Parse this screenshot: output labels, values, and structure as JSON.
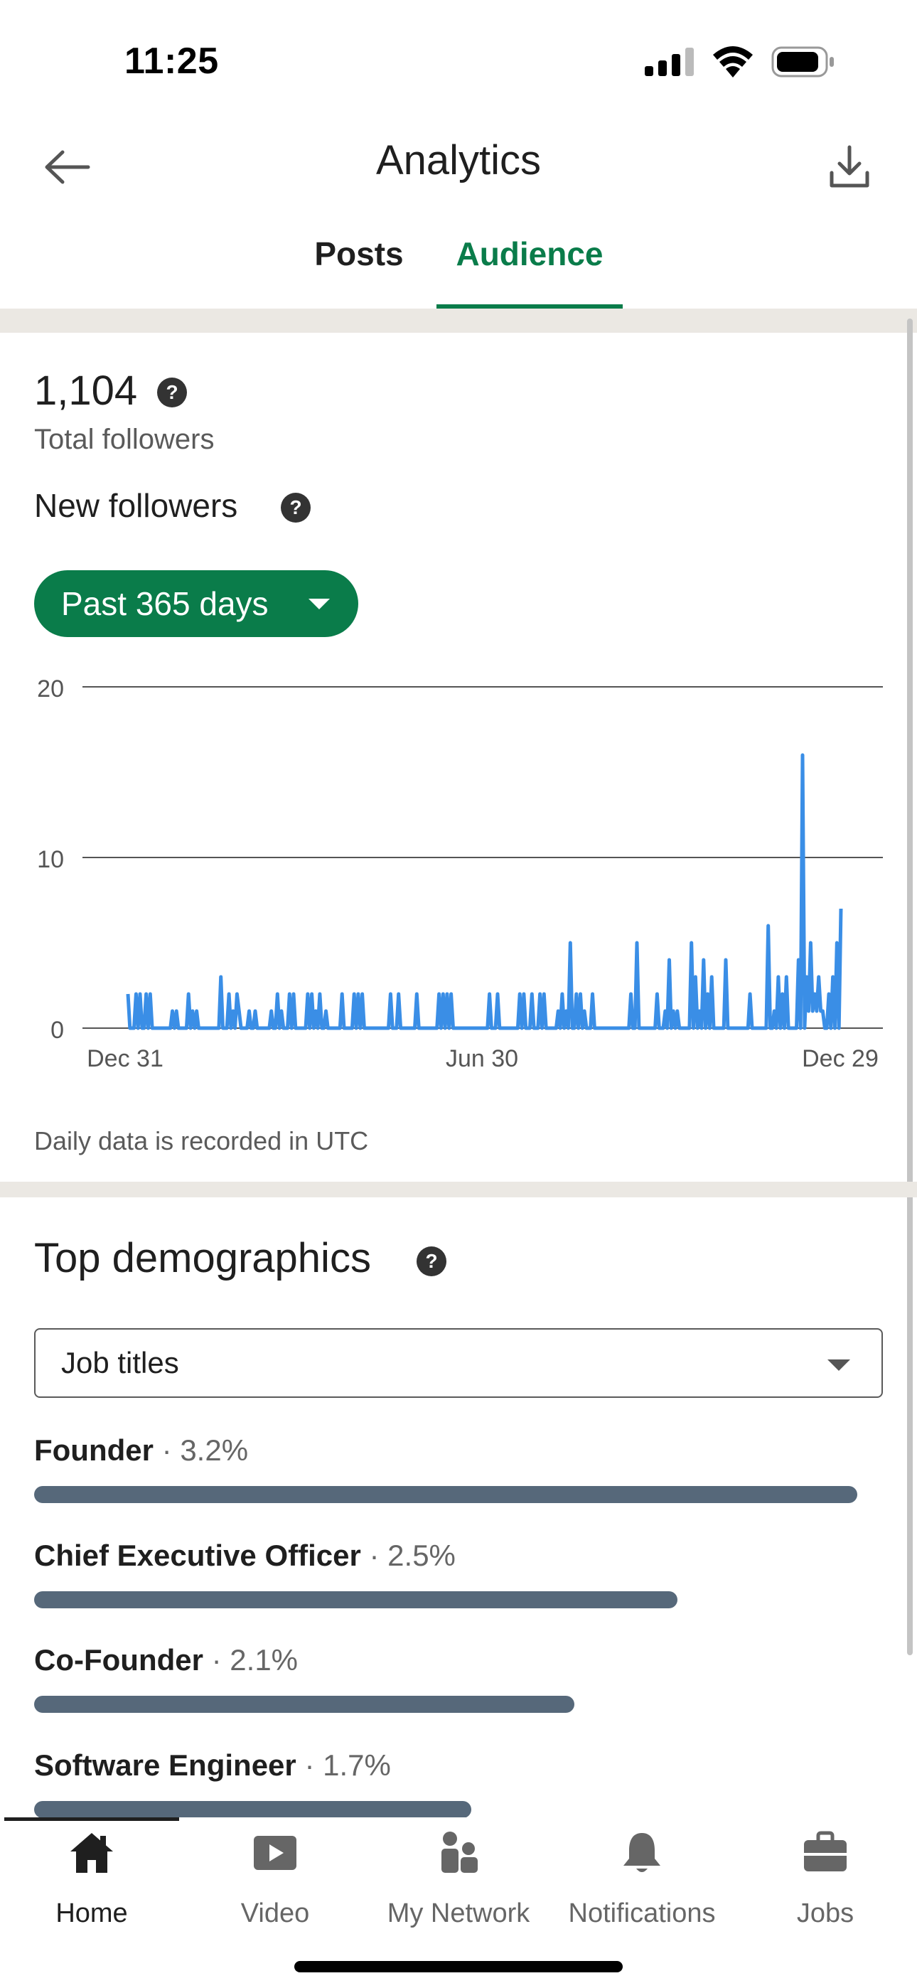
{
  "status_bar": {
    "time": "11:25"
  },
  "header": {
    "title": "Analytics"
  },
  "tabs": [
    {
      "label": "Posts",
      "active": false
    },
    {
      "label": "Audience",
      "active": true
    }
  ],
  "followers": {
    "total": "1,104",
    "total_label": "Total followers",
    "new_label": "New followers",
    "range": "Past 365 days",
    "note": "Daily data is recorded in UTC"
  },
  "chart_data": {
    "type": "line",
    "title": "",
    "xlabel": "",
    "ylabel": "",
    "ylim": [
      0,
      20
    ],
    "yticks": [
      "0",
      "10",
      "20"
    ],
    "xticks": [
      "Dec 31",
      "Jun 30",
      "Dec 29"
    ],
    "grid": true,
    "series": [
      {
        "values": [
          2,
          0,
          0,
          0,
          2,
          0,
          2,
          0,
          0,
          2,
          0,
          2,
          0,
          0,
          0,
          0,
          0,
          0,
          0,
          0,
          0,
          0,
          1,
          0,
          1,
          0,
          0,
          0,
          0,
          0,
          2,
          0,
          1,
          0,
          1,
          0,
          0,
          0,
          0,
          0,
          0,
          0,
          0,
          0,
          0,
          0,
          3,
          0,
          0,
          0,
          2,
          0,
          1,
          0,
          2,
          1,
          0,
          0,
          0,
          0,
          1,
          0,
          0,
          1,
          0,
          0,
          0,
          0,
          0,
          0,
          0,
          1,
          0,
          0,
          2,
          0,
          1,
          0,
          0,
          0,
          2,
          0,
          2,
          0,
          0,
          0,
          0,
          0,
          0,
          2,
          0,
          2,
          0,
          1,
          0,
          2,
          0,
          0,
          1,
          0,
          0,
          0,
          0,
          0,
          0,
          0,
          2,
          0,
          0,
          0,
          0,
          0,
          2,
          0,
          2,
          0,
          2,
          0,
          0,
          0,
          0,
          0,
          0,
          0,
          0,
          0,
          0,
          0,
          0,
          0,
          2,
          0,
          0,
          0,
          2,
          0,
          0,
          0,
          0,
          0,
          0,
          0,
          0,
          2,
          0,
          0,
          0,
          0,
          0,
          0,
          0,
          0,
          0,
          0,
          2,
          0,
          2,
          0,
          2,
          0,
          2,
          0,
          0,
          0,
          0,
          0,
          0,
          0,
          0,
          0,
          0,
          0,
          0,
          0,
          0,
          0,
          0,
          0,
          0,
          2,
          0,
          0,
          0,
          2,
          0,
          0,
          0,
          0,
          0,
          0,
          0,
          0,
          0,
          0,
          2,
          0,
          2,
          0,
          0,
          0,
          2,
          0,
          0,
          0,
          2,
          0,
          2,
          0,
          0,
          0,
          0,
          0,
          0,
          1,
          0,
          2,
          0,
          1,
          0,
          5,
          0,
          0,
          2,
          0,
          2,
          0,
          1,
          0,
          0,
          0,
          2,
          0,
          0,
          0,
          0,
          0,
          0,
          0,
          0,
          0,
          0,
          0,
          0,
          0,
          0,
          0,
          0,
          0,
          0,
          2,
          0,
          0,
          5,
          0,
          0,
          0,
          0,
          0,
          0,
          0,
          0,
          0,
          2,
          0,
          0,
          0,
          1,
          0,
          4,
          0,
          1,
          0,
          1,
          0,
          0,
          0,
          0,
          0,
          0,
          5,
          0,
          3,
          0,
          1,
          0,
          4,
          0,
          2,
          0,
          3,
          0,
          0,
          0,
          0,
          0,
          0,
          4,
          0,
          0,
          0,
          0,
          0,
          0,
          0,
          0,
          0,
          0,
          0,
          2,
          0,
          0,
          0,
          0,
          0,
          0,
          0,
          0,
          6,
          0,
          0,
          1,
          0,
          3,
          0,
          2,
          0,
          3,
          0,
          0,
          0,
          0,
          0,
          4,
          0,
          16,
          0,
          3,
          1,
          5,
          1,
          2,
          1,
          3,
          1,
          1,
          0,
          0,
          2,
          0,
          3,
          0,
          5,
          0,
          7
        ]
      }
    ]
  },
  "demographics": {
    "title": "Top demographics",
    "selector": "Job titles",
    "items": [
      {
        "title": "Founder",
        "sep": "·",
        "pct": "3.2%",
        "value": 3.2
      },
      {
        "title": "Chief Executive Officer",
        "sep": "·",
        "pct": "2.5%",
        "value": 2.5
      },
      {
        "title": "Co-Founder",
        "sep": "·",
        "pct": "2.1%",
        "value": 2.1
      },
      {
        "title": "Software Engineer",
        "sep": "·",
        "pct": "1.7%",
        "value": 1.7
      }
    ]
  },
  "bottom_nav": [
    {
      "label": "Home",
      "icon": "home-icon",
      "active": true
    },
    {
      "label": "Video",
      "icon": "video-icon",
      "active": false
    },
    {
      "label": "My Network",
      "icon": "network-icon",
      "active": false
    },
    {
      "label": "Notifications",
      "icon": "bell-icon",
      "active": false
    },
    {
      "label": "Jobs",
      "icon": "briefcase-icon",
      "active": false
    }
  ],
  "colors": {
    "accent": "#0a7c4a",
    "line": "#3a8ee6",
    "bar": "#56687a",
    "divider": "#ebe8e3"
  }
}
